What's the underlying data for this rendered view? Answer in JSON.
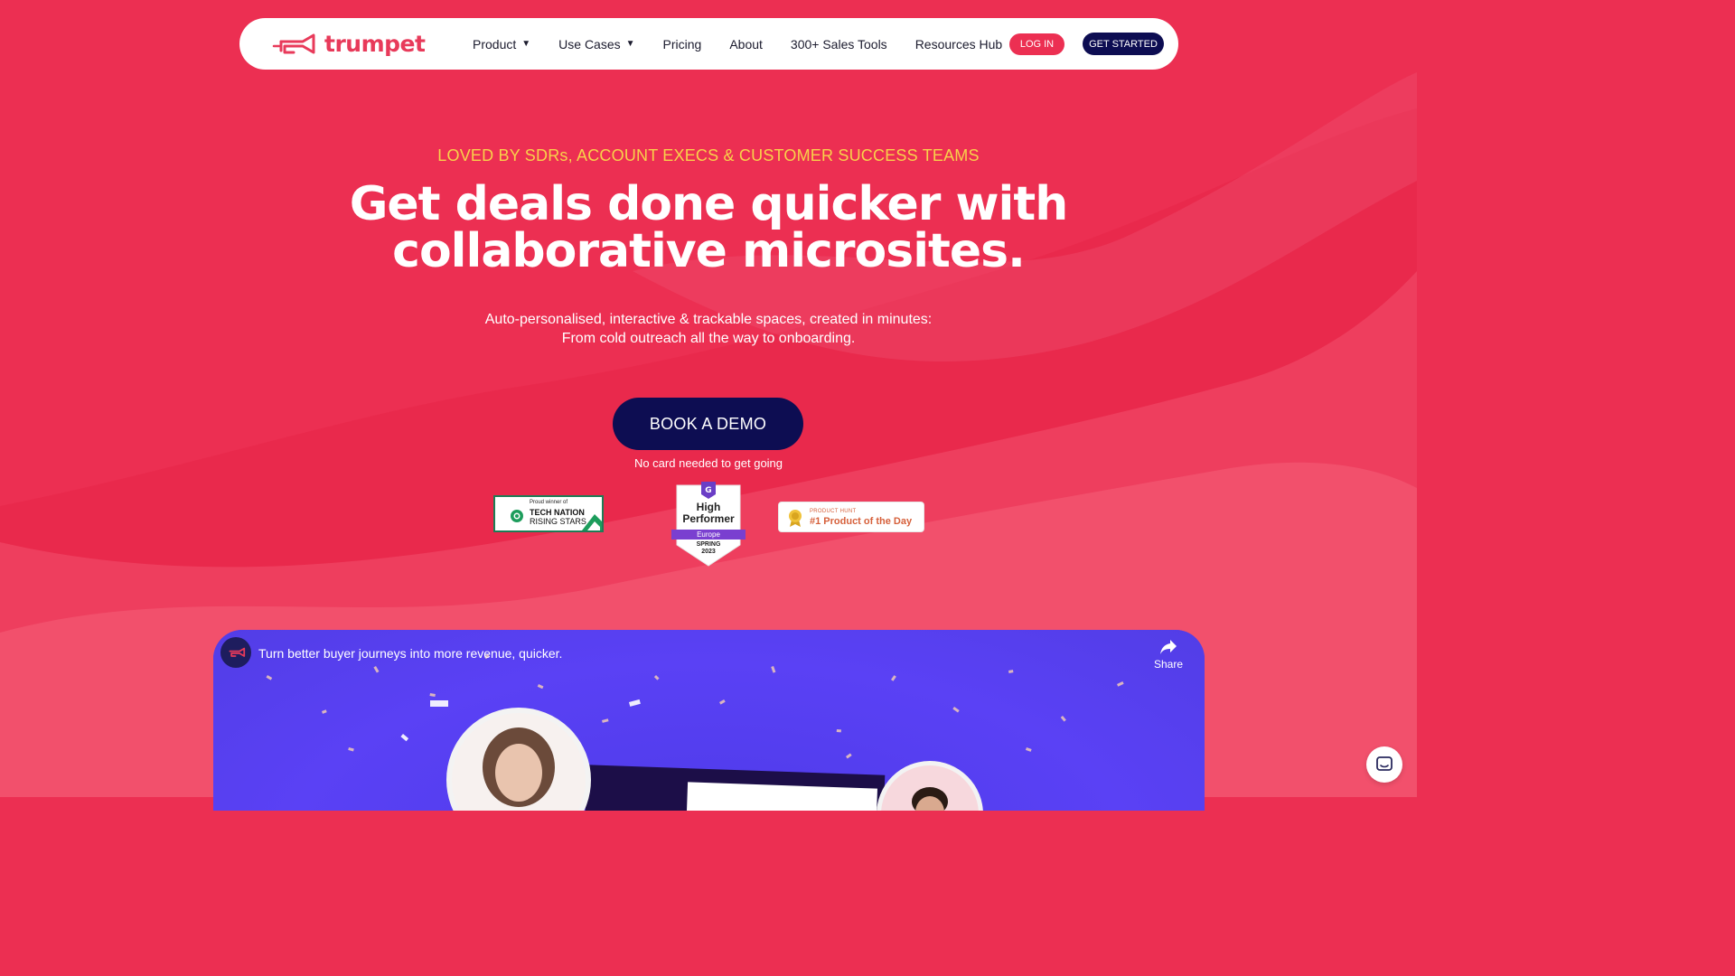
{
  "nav": {
    "logo_text": "trumpet",
    "links": [
      {
        "label": "Product",
        "has_caret": true
      },
      {
        "label": "Use Cases",
        "has_caret": true
      },
      {
        "label": "Pricing",
        "has_caret": false
      },
      {
        "label": "About",
        "has_caret": false
      },
      {
        "label": "300+ Sales Tools",
        "has_caret": false
      },
      {
        "label": "Resources Hub",
        "has_caret": false
      }
    ],
    "login_label": "LOG IN",
    "get_started_label": "GET STARTED"
  },
  "hero": {
    "eyebrow": "LOVED BY SDRs, ACCOUNT EXECS & CUSTOMER SUCCESS TEAMS",
    "headline_line1": "Get deals done quicker with",
    "headline_line2": "collaborative microsites.",
    "sub_line1": "Auto-personalised, interactive & trackable spaces, created in minutes:",
    "sub_line2": "From cold outreach all the way to onboarding.",
    "cta_label": "BOOK A DEMO",
    "cta_note": "No card needed to get going"
  },
  "badges": {
    "tech_nation": {
      "small": "Proud winner of",
      "main": "TECH NATION",
      "sub": "RISING STARS"
    },
    "g2": {
      "line1": "High",
      "line2": "Performer",
      "region": "Europe",
      "season": "SPRING",
      "year": "2023"
    },
    "product_hunt": {
      "small": "PRODUCT HUNT",
      "main": "#1 Product of the Day"
    }
  },
  "video": {
    "title": "Turn better buyer journeys into more revenue, quicker.",
    "share_label": "Share"
  },
  "colors": {
    "brand_pink": "#ec2f52",
    "navy": "#0d0d52",
    "eyebrow_yellow": "#f8d24a",
    "video_purple": "#5a3ff1"
  },
  "icons": {
    "logo": "trumpet-logo-icon",
    "caret": "chevron-down-icon",
    "share": "share-arrow-icon",
    "chat": "chat-icon"
  }
}
